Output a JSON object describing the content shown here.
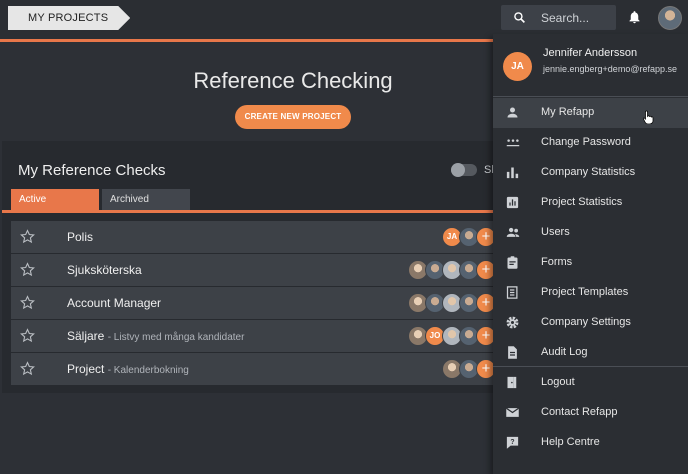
{
  "header": {
    "breadcrumb": "MY PROJECTS",
    "search_placeholder": "Search..."
  },
  "main": {
    "title": "Reference Checking",
    "create_button": "CREATE NEW PROJECT",
    "panel_title": "My Reference Checks",
    "toggle_label": "Sh",
    "tabs": [
      {
        "label": "Active",
        "active": true
      },
      {
        "label": "Archived",
        "active": false
      }
    ],
    "rows": [
      {
        "name": "Polis",
        "sub": ""
      },
      {
        "name": "Sjuksköterska",
        "sub": ""
      },
      {
        "name": "Account Manager",
        "sub": ""
      },
      {
        "name": "Säljare",
        "sub": "- Listvy med många kandidater"
      },
      {
        "name": "Project",
        "sub": "- Kalenderbokning"
      }
    ],
    "avatars": {
      "ja_initials": "JA",
      "jo_initials": "JO",
      "add": "+"
    }
  },
  "user_menu": {
    "initials": "JA",
    "name": "Jennifer Andersson",
    "email": "jennie.engberg+demo@refapp.se",
    "items": [
      {
        "label": "My Refapp",
        "icon": "person-icon"
      },
      {
        "label": "Change Password",
        "icon": "password-icon"
      },
      {
        "label": "Company Statistics",
        "icon": "bar-chart-icon"
      },
      {
        "label": "Project Statistics",
        "icon": "chart-box-icon"
      },
      {
        "label": "Users",
        "icon": "people-icon"
      },
      {
        "label": "Forms",
        "icon": "clipboard-icon"
      },
      {
        "label": "Project Templates",
        "icon": "templates-icon"
      },
      {
        "label": "Company Settings",
        "icon": "gear-icon"
      },
      {
        "label": "Audit Log",
        "icon": "document-icon"
      },
      {
        "label": "Logout",
        "icon": "logout-icon"
      },
      {
        "label": "Contact Refapp",
        "icon": "mail-icon"
      },
      {
        "label": "Help Centre",
        "icon": "help-icon"
      }
    ]
  },
  "colors": {
    "accent": "#f08a4b",
    "background": "#2d3036"
  }
}
